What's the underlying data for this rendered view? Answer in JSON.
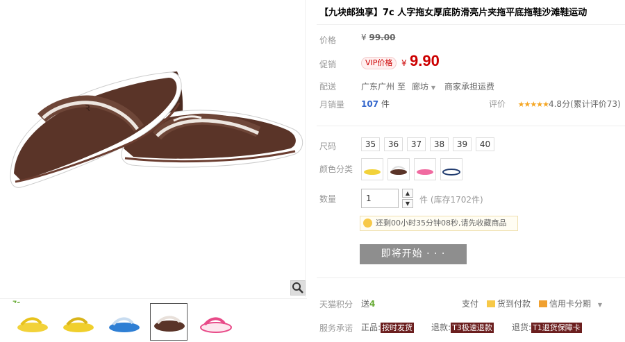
{
  "product": {
    "title": "【九块邮独享】7c 人字拖女厚底防滑亮片夹拖平底拖鞋沙滩鞋运动"
  },
  "price": {
    "label": "价格",
    "currency": "¥",
    "original": "99.00"
  },
  "promo": {
    "label": "促销",
    "badge": "VIP价格",
    "currency": "¥",
    "price": "9.90"
  },
  "shipping": {
    "label": "配送",
    "from": "广东广州",
    "to_word": "至",
    "destination": "廊坊",
    "fee": "商家承担运费"
  },
  "sales": {
    "label": "月销量",
    "count": "107",
    "unit": "件"
  },
  "rating": {
    "label": "评价",
    "stars": "★★★★★",
    "text": "4.8分(累计评价73)"
  },
  "sizes": {
    "label": "尺码",
    "options": [
      "35",
      "36",
      "37",
      "38",
      "39",
      "40"
    ]
  },
  "colors": {
    "label": "颜色分类",
    "options": [
      "yellow",
      "brown",
      "pink",
      "navy"
    ]
  },
  "quantity": {
    "label": "数量",
    "value": "1",
    "stock": "件 (库存1702件)"
  },
  "notice": {
    "text": "还剩00小时35分钟08秒,请先收藏商品"
  },
  "start_button": {
    "label": "即将开始 · · ·"
  },
  "points": {
    "label": "天猫积分",
    "prefix": "送",
    "value": "4"
  },
  "payment": {
    "label": "支付",
    "cod": "货到付款",
    "installment": "信用卡分期"
  },
  "promise": {
    "label": "服务承诺",
    "items": [
      {
        "prefix": "正品",
        "tag": "按时发货"
      },
      {
        "prefix": "退款",
        "tag": "T3极速退款"
      },
      {
        "prefix": "退货",
        "tag": "T1退货保障卡"
      }
    ]
  },
  "gallery": {
    "badge": "7c"
  },
  "colors_hex": {
    "accent_red": "#c00000",
    "sales_blue": "#3366cc",
    "star_orange": "#f5a623",
    "button_gray": "#8e8e8e"
  }
}
